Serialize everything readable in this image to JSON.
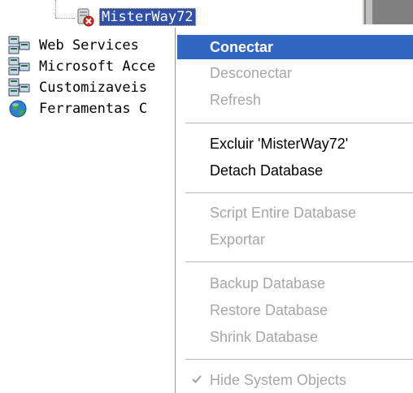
{
  "tree": {
    "selected_item": {
      "label": "MisterWay72",
      "icon": "database-offline-icon"
    },
    "items": [
      {
        "label": "Web Services",
        "icon": "server-group-icon"
      },
      {
        "label": "Microsoft Acce",
        "icon": "server-group-icon"
      },
      {
        "label": "Customizaveis",
        "icon": "server-group-icon"
      },
      {
        "label": "Ferramentas C",
        "icon": "globe-icon"
      }
    ]
  },
  "context_menu": {
    "items": {
      "conectar": "Conectar",
      "desconectar": "Desconectar",
      "refresh": "Refresh",
      "excluir": "Excluir 'MisterWay72'",
      "detach": "Detach Database",
      "script": "Script Entire Database",
      "exportar": "Exportar",
      "backup": "Backup Database",
      "restore": "Restore Database",
      "shrink": "Shrink Database",
      "hide_system": "Hide System Objects"
    }
  },
  "colors": {
    "selection": "#3167c2",
    "tree_selection": "#2f4fa8",
    "disabled_text": "#a7a6aa"
  }
}
